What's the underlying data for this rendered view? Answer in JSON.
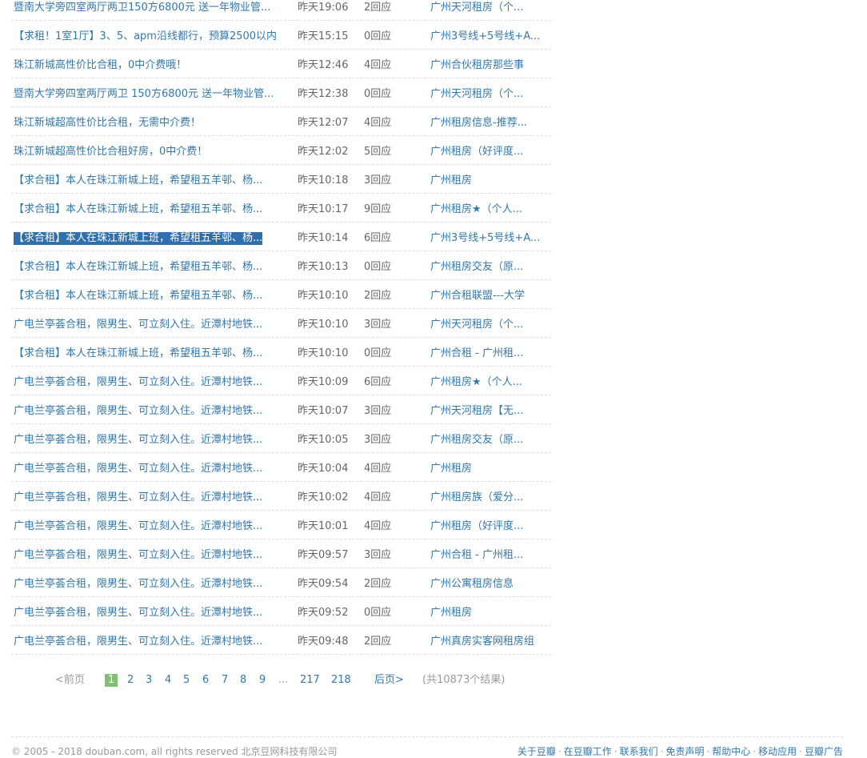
{
  "results": [
    {
      "title": "暨南大学旁四室两厅两卫150方6800元 送一年物业管...",
      "time": "昨天19:06",
      "replies": "2回应",
      "group": "广州天河租房（个..."
    },
    {
      "title": "【求租！1室1厅】3、5、apm沿线都行，预算2500以内",
      "time": "昨天15:15",
      "replies": "0回应",
      "group": "广州3号线+5号线+A..."
    },
    {
      "title": "珠江新城高性价比合租，0中介费哦！",
      "time": "昨天12:46",
      "replies": "4回应",
      "group": "广州合伙租房那些事"
    },
    {
      "title": "暨南大学旁四室两厅两卫 150方6800元 送一年物业管...",
      "time": "昨天12:38",
      "replies": "0回应",
      "group": "广州天河租房（个..."
    },
    {
      "title": "珠江新城超高性价比合租，无需中介费！",
      "time": "昨天12:07",
      "replies": "4回应",
      "group": "广州租房信息-推荐..."
    },
    {
      "title": "珠江新城超高性价比合租好房，0中介费！",
      "time": "昨天12:02",
      "replies": "5回应",
      "group": "广州租房（好评度..."
    },
    {
      "title": "【求合租】本人在珠江新城上班，希望租五羊邨、杨...",
      "time": "昨天10:18",
      "replies": "3回应",
      "group": "广州租房"
    },
    {
      "title": "【求合租】本人在珠江新城上班，希望租五羊邨、杨...",
      "time": "昨天10:17",
      "replies": "9回应",
      "group": "广州租房★（个人..."
    },
    {
      "title": "【求合租】本人在珠江新城上班，希望租五羊邨、杨...",
      "time": "昨天10:14",
      "replies": "6回应",
      "group": "广州3号线+5号线+A...",
      "selected": true
    },
    {
      "title": "【求合租】本人在珠江新城上班，希望租五羊邨、杨...",
      "time": "昨天10:13",
      "replies": "0回应",
      "group": "广州租房交友（原..."
    },
    {
      "title": "【求合租】本人在珠江新城上班，希望租五羊邨、杨...",
      "time": "昨天10:10",
      "replies": "2回应",
      "group": "广州合租联盟---大学"
    },
    {
      "title": "广电兰亭荟合租，限男生、可立刻入住。近潭村地铁...",
      "time": "昨天10:10",
      "replies": "3回应",
      "group": "广州天河租房（个..."
    },
    {
      "title": "【求合租】本人在珠江新城上班，希望租五羊邨、杨...",
      "time": "昨天10:10",
      "replies": "0回应",
      "group": "广州合租 - 广州租..."
    },
    {
      "title": "广电兰亭荟合租，限男生、可立刻入住。近潭村地铁...",
      "time": "昨天10:09",
      "replies": "6回应",
      "group": "广州租房★（个人..."
    },
    {
      "title": "广电兰亭荟合租，限男生、可立刻入住。近潭村地铁...",
      "time": "昨天10:07",
      "replies": "3回应",
      "group": "广州天河租房【无..."
    },
    {
      "title": "广电兰亭荟合租，限男生、可立刻入住。近潭村地铁...",
      "time": "昨天10:05",
      "replies": "3回应",
      "group": "广州租房交友（原..."
    },
    {
      "title": "广电兰亭荟合租，限男生、可立刻入住。近潭村地铁...",
      "time": "昨天10:04",
      "replies": "4回应",
      "group": "广州租房"
    },
    {
      "title": "广电兰亭荟合租，限男生、可立刻入住。近潭村地铁...",
      "time": "昨天10:02",
      "replies": "4回应",
      "group": "广州租房族（爱分..."
    },
    {
      "title": "广电兰亭荟合租，限男生、可立刻入住。近潭村地铁...",
      "time": "昨天10:01",
      "replies": "4回应",
      "group": "广州租房（好评度..."
    },
    {
      "title": "广电兰亭荟合租，限男生、可立刻入住。近潭村地铁...",
      "time": "昨天09:57",
      "replies": "3回应",
      "group": "广州合租 - 广州租..."
    },
    {
      "title": "广电兰亭荟合租，限男生、可立刻入住。近潭村地铁...",
      "time": "昨天09:54",
      "replies": "2回应",
      "group": "广州公寓租房信息"
    },
    {
      "title": "广电兰亭荟合租，限男生、可立刻入住。近潭村地铁...",
      "time": "昨天09:52",
      "replies": "0回应",
      "group": "广州租房"
    },
    {
      "title": "广电兰亭荟合租，限男生、可立刻入住。近潭村地铁...",
      "time": "昨天09:48",
      "replies": "2回应",
      "group": "广州真房实客网租房组"
    }
  ],
  "paginator": {
    "prev": "<前页",
    "current": "1",
    "pages": [
      "2",
      "3",
      "4",
      "5",
      "6",
      "7",
      "8",
      "9"
    ],
    "dots": "...",
    "tail_pages": [
      "217",
      "218"
    ],
    "next": "后页>",
    "count": "(共10873个结果)"
  },
  "footer": {
    "copyright": "© 2005 - 2018 douban.com, all rights reserved 北京豆网科技有限公司",
    "links": [
      "关于豆瓣",
      "在豆瓣工作",
      "联系我们",
      "免责声明",
      "帮助中心",
      "移动应用",
      "豆瓣广告"
    ],
    "separator": "·"
  }
}
